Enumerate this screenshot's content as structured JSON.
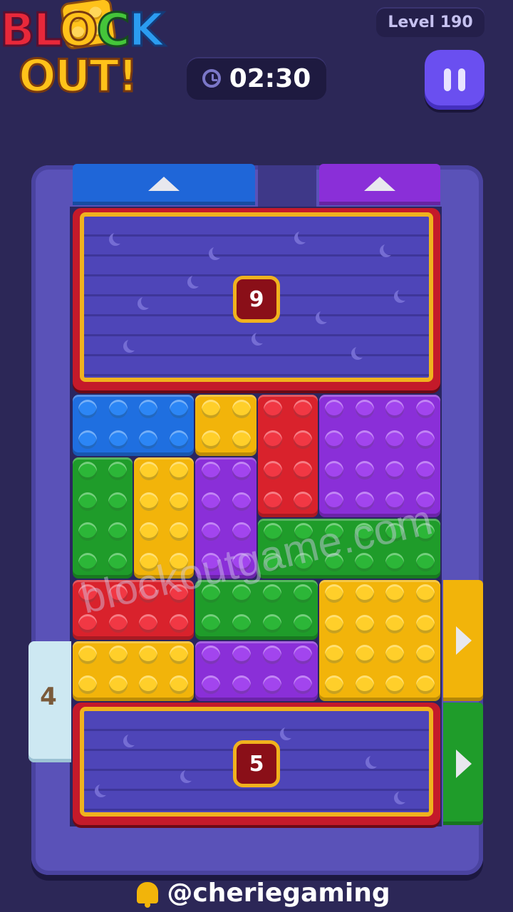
{
  "header": {
    "logo_line1": "BLOCK",
    "logo_line2": "OUT!",
    "level_label": "Level 190",
    "timer": "02:30",
    "clock_icon": "clock-icon",
    "pause_icon": "pause-icon"
  },
  "board": {
    "top_gates": [
      {
        "color": "#1f66d8",
        "direction": "up"
      },
      {
        "color": "#8a2fd8",
        "direction": "up"
      }
    ],
    "right_gates": [
      {
        "color": "#f2b40a",
        "direction": "right"
      },
      {
        "color": "#1f9c2a",
        "direction": "right"
      }
    ],
    "left_gate": {
      "type": "ice",
      "count": "4"
    },
    "locked_crates": [
      {
        "position": "top",
        "count": "9"
      },
      {
        "position": "bottom",
        "count": "5"
      }
    ],
    "blocks": [
      {
        "color": "blue",
        "studs": "4x2"
      },
      {
        "color": "yellow",
        "studs": "2x2"
      },
      {
        "color": "red",
        "studs": "2x4"
      },
      {
        "color": "purple",
        "studs": "4x4"
      },
      {
        "color": "green",
        "studs": "2x4"
      },
      {
        "color": "yellow",
        "studs": "2x4"
      },
      {
        "color": "purple",
        "studs": "2x4"
      },
      {
        "color": "green",
        "studs": "6x2"
      },
      {
        "color": "red",
        "studs": "4x2"
      },
      {
        "color": "green",
        "studs": "4x2"
      },
      {
        "color": "yellow",
        "studs": "4x4"
      },
      {
        "color": "yellow",
        "studs": "4x2"
      },
      {
        "color": "purple",
        "studs": "4x2"
      }
    ]
  },
  "watermark": "blockoutgame.com",
  "footer": {
    "handle": "@cheriegaming",
    "bell_icon": "bell-icon"
  }
}
